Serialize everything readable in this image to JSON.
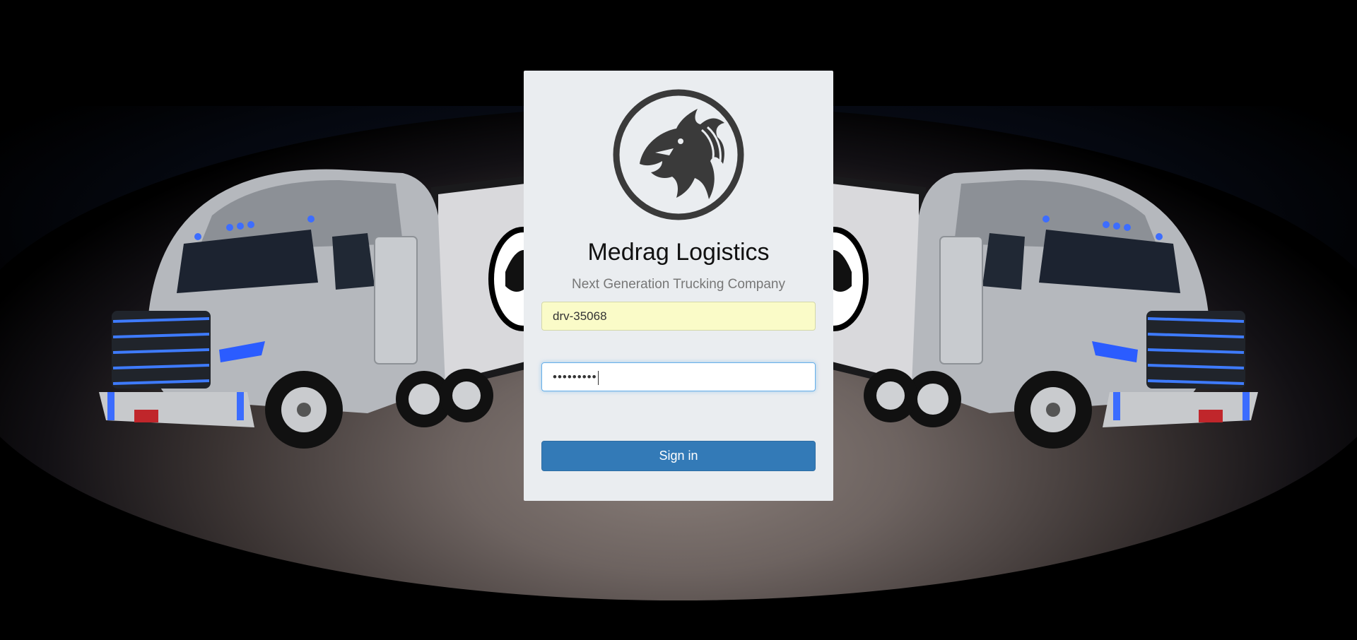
{
  "brand": {
    "title": "Medrag Logistics",
    "subtitle": "Next Generation Trucking Company",
    "logo_icon": "dragon-logo-icon"
  },
  "login": {
    "username_value": "drv-35068",
    "password_mask": "•••••••••",
    "signin_label": "Sign in"
  },
  "background": {
    "image": "semi-truck-night-mirrored",
    "accent_light": "#2b5cff"
  },
  "colors": {
    "card_bg": "#eaedf0",
    "button_bg": "#337ab7",
    "autofill_bg": "#fafbc8",
    "focus_border": "#66afe9"
  }
}
